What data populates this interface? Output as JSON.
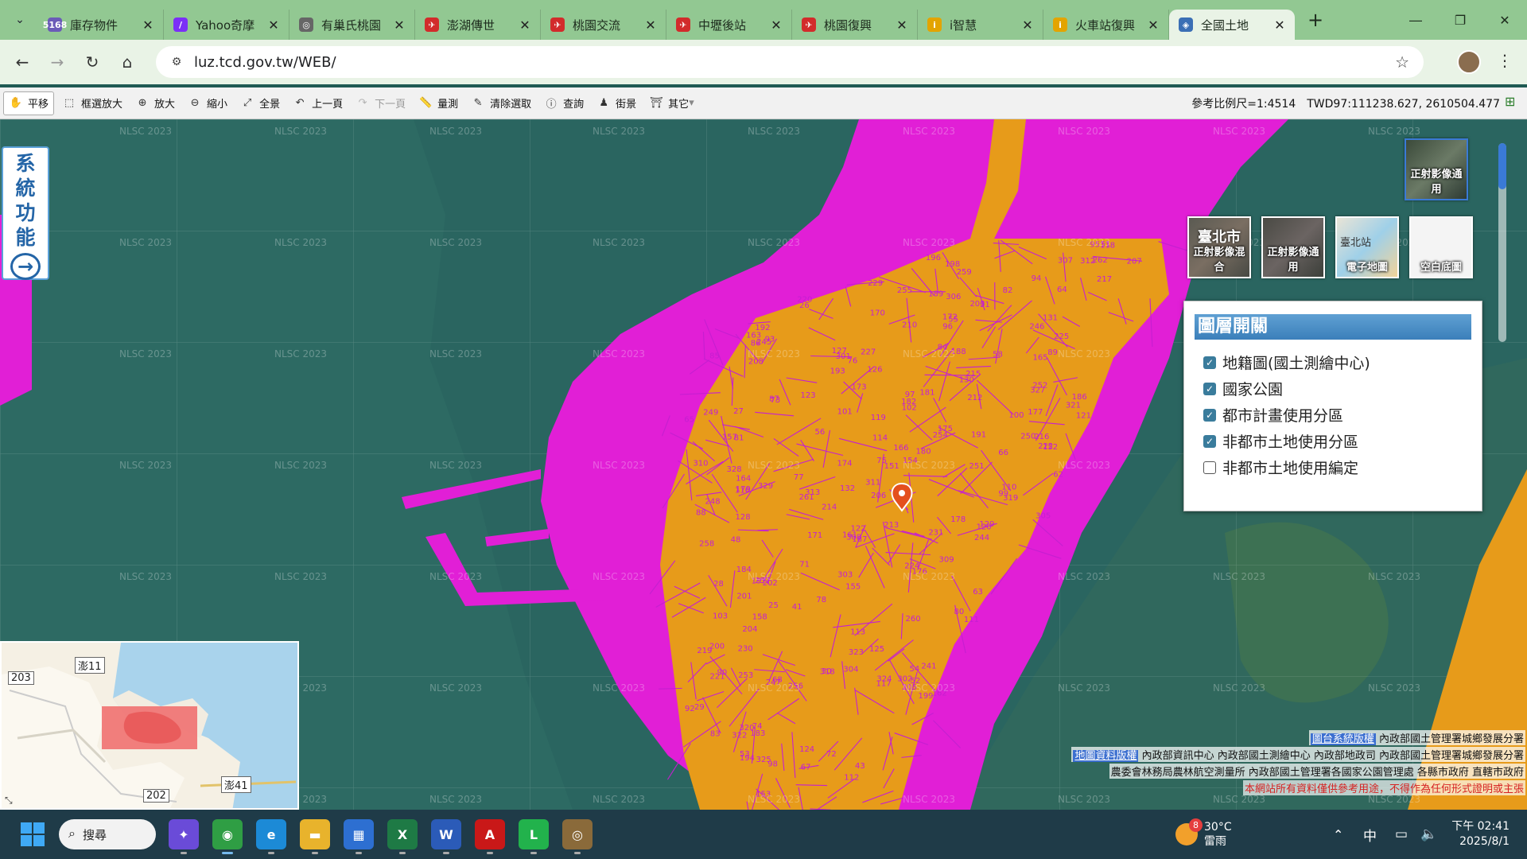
{
  "browser": {
    "tabs": [
      {
        "title": "庫存物件",
        "icon": "5168",
        "color": "#6b5bb8"
      },
      {
        "title": "Yahoo奇摩",
        "icon": "/",
        "color": "#7b2ff7"
      },
      {
        "title": "有巢氏桃園",
        "icon": "◎",
        "color": "#666666"
      },
      {
        "title": "澎湖傳世",
        "icon": "✈",
        "color": "#d22b2b"
      },
      {
        "title": "桃園交流",
        "icon": "✈",
        "color": "#d22b2b"
      },
      {
        "title": "中壢後站",
        "icon": "✈",
        "color": "#d22b2b"
      },
      {
        "title": "桃園復興",
        "icon": "✈",
        "color": "#d22b2b"
      },
      {
        "title": "i智慧",
        "icon": "i",
        "color": "#e3a400"
      },
      {
        "title": "火車站復興",
        "icon": "i",
        "color": "#e3a400"
      },
      {
        "title": "全國土地",
        "icon": "◈",
        "color": "#3b6fb5"
      }
    ],
    "active_tab_index": 9,
    "url": "luz.tcd.gov.tw/WEB/"
  },
  "toolbar": {
    "tools": [
      {
        "label": "平移",
        "icon": "pan-icon",
        "glyph": "✋",
        "active": true
      },
      {
        "label": "框選放大",
        "icon": "box-zoom-icon",
        "glyph": "⬚"
      },
      {
        "label": "放大",
        "icon": "zoom-in-icon",
        "glyph": "⊕"
      },
      {
        "label": "縮小",
        "icon": "zoom-out-icon",
        "glyph": "⊖"
      },
      {
        "label": "全景",
        "icon": "full-extent-icon",
        "glyph": "⤢"
      },
      {
        "label": "上一頁",
        "icon": "previous-view-icon",
        "glyph": "↶"
      },
      {
        "label": "下一頁",
        "icon": "next-view-icon",
        "glyph": "↷",
        "disabled": true
      },
      {
        "label": "量測",
        "icon": "measure-icon",
        "glyph": "📏"
      },
      {
        "label": "清除選取",
        "icon": "clear-selection-icon",
        "glyph": "✎"
      },
      {
        "label": "查詢",
        "icon": "info-icon",
        "glyph": "ⓘ"
      },
      {
        "label": "街景",
        "icon": "street-view-icon",
        "glyph": "♟"
      },
      {
        "label": "其它",
        "icon": "more-icon",
        "glyph": "⛩",
        "dropdown": true
      }
    ],
    "scale_text": "參考比例尺=1:4514",
    "coord_text": "TWD97:111238.627, 2610504.477"
  },
  "map": {
    "watermark": "NLSC 2023",
    "side_button": {
      "chars": [
        "系",
        "統",
        "功",
        "能"
      ]
    },
    "basemaps": [
      {
        "label": "正射影像通用",
        "selected": true
      },
      {
        "label": "正射影像混合",
        "text": "臺北市"
      },
      {
        "label": "正射影像通用"
      },
      {
        "label": "電子地圖",
        "text": "臺北站"
      },
      {
        "label": "空白底圖"
      }
    ],
    "layer_panel": {
      "title": "圖層開關",
      "layers": [
        {
          "label": "地籍圖(國土測繪中心)",
          "checked": true
        },
        {
          "label": "國家公園",
          "checked": true
        },
        {
          "label": "都市計畫使用分區",
          "checked": true
        },
        {
          "label": "非都市土地使用分區",
          "checked": true
        },
        {
          "label": "非都市土地使用編定",
          "checked": false
        }
      ]
    },
    "overview_labels": [
      "澎11",
      "203",
      "澎41",
      "202"
    ],
    "parcel_numbers": [
      "25",
      "26",
      "27",
      "28",
      "29",
      "30",
      "55",
      "71",
      "72",
      "73",
      "74",
      "75",
      "76",
      "77",
      "78",
      "80",
      "81",
      "82",
      "83",
      "84",
      "85",
      "86",
      "87",
      "88",
      "89",
      "90",
      "91",
      "92",
      "93",
      "94",
      "95",
      "96",
      "97",
      "98",
      "99",
      "100",
      "101",
      "102",
      "103",
      "110",
      "111",
      "112",
      "113",
      "114",
      "116",
      "117",
      "118",
      "119",
      "120",
      "121",
      "122",
      "123",
      "124",
      "125",
      "126",
      "127",
      "128",
      "129",
      "130",
      "131",
      "132",
      "151",
      "152",
      "153",
      "154",
      "155",
      "157",
      "158",
      "161",
      "162",
      "163",
      "164",
      "165",
      "166",
      "170",
      "171",
      "172",
      "173",
      "174",
      "175",
      "176",
      "177",
      "178",
      "179",
      "180",
      "181",
      "182",
      "183",
      "184",
      "186",
      "187",
      "188",
      "189",
      "191",
      "192",
      "193",
      "194",
      "196",
      "197",
      "198",
      "199",
      "200",
      "201",
      "202",
      "203",
      "204",
      "205",
      "206",
      "207",
      "208",
      "210",
      "212",
      "213",
      "214",
      "215",
      "216",
      "217",
      "219",
      "220",
      "221",
      "222",
      "224",
      "225",
      "227",
      "229",
      "230",
      "231",
      "241",
      "244",
      "245",
      "246",
      "247",
      "248",
      "249",
      "250",
      "251",
      "252",
      "253",
      "254",
      "255",
      "256",
      "257",
      "258",
      "259",
      "260",
      "261",
      "262",
      "301",
      "302",
      "303",
      "304",
      "305",
      "306",
      "307",
      "308",
      "309",
      "310",
      "311",
      "312",
      "313",
      "318",
      "319",
      "320",
      "321",
      "322",
      "323",
      "324",
      "325",
      "327",
      "328",
      "329",
      "41",
      "43",
      "48",
      "51",
      "52",
      "53",
      "54",
      "56",
      "58",
      "62",
      "63",
      "64",
      "65",
      "66",
      "67",
      "68"
    ],
    "attribution": {
      "line1_link": "圖台系統版權",
      "line1_text": "內政部國土管理署城鄉發展分署",
      "line2_link": "地圖資料版權",
      "line2_text": "內政部資訊中心 內政部國土測繪中心 內政部地政司 內政部國土管理署城鄉發展分署",
      "line3_text": "農委會林務局農林航空測量所 內政部國土管理署各國家公園管理處 各縣市政府 直轄市政府",
      "line4_text": "本網站所有資料僅供參考用途，不得作為任何形式證明或主張"
    },
    "colors": {
      "national_park": "#e11fd6",
      "urban_zone": "#e79b1a",
      "cadastral": "#c51fd0",
      "sea": "#2a6560"
    }
  },
  "taskbar": {
    "search_label": "搜尋",
    "apps": [
      {
        "name": "copilot",
        "glyph": "✦",
        "color": "#6a4bd8"
      },
      {
        "name": "chrome",
        "glyph": "◉",
        "color": "#2f9e44",
        "active": true
      },
      {
        "name": "edge",
        "glyph": "e",
        "color": "#1c8ad6"
      },
      {
        "name": "file-explorer",
        "glyph": "▬",
        "color": "#e8b32c"
      },
      {
        "name": "microsoft-store",
        "glyph": "▦",
        "color": "#2d6fd1"
      },
      {
        "name": "excel",
        "glyph": "X",
        "color": "#1e7a45"
      },
      {
        "name": "word",
        "glyph": "W",
        "color": "#2b5bb8"
      },
      {
        "name": "acrobat",
        "glyph": "A",
        "color": "#c91818"
      },
      {
        "name": "line",
        "glyph": "L",
        "color": "#22b24c"
      },
      {
        "name": "camera-app",
        "glyph": "◎",
        "color": "#8a6a3a"
      }
    ],
    "weather_temp": "30°C",
    "weather_desc": "雷雨",
    "weather_badge": "8",
    "ime": "中",
    "time": "下午 02:41",
    "date": "2025/8/1"
  }
}
